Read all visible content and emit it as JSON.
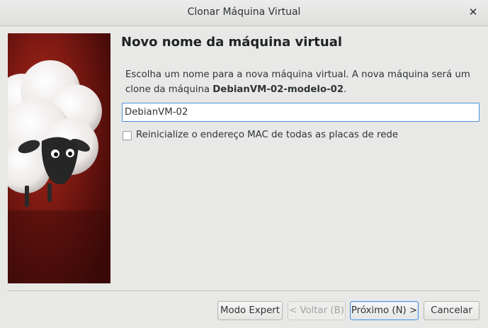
{
  "window": {
    "title": "Clonar Máquina Virtual",
    "close_glyph": "✕"
  },
  "page": {
    "heading": "Novo nome da máquina virtual",
    "description_part1": "Escolha um nome para a nova máquina virtual. A nova máquina será um clone da máquina ",
    "source_vm": "DebianVM-02-modelo-02",
    "description_end": "."
  },
  "form": {
    "name_value": "DebianVM-02",
    "reinit_mac_label": "Reinicialize o endereço MAC de todas as placas de rede",
    "reinit_mac_checked": false
  },
  "buttons": {
    "expert": "Modo Expert",
    "back": "< Voltar (B)",
    "next": "Próximo (N) >",
    "cancel": "Cancelar"
  },
  "colors": {
    "accent": "#4a90d9",
    "banner_dark": "#4a0a0a",
    "banner_light": "#b0291c"
  }
}
